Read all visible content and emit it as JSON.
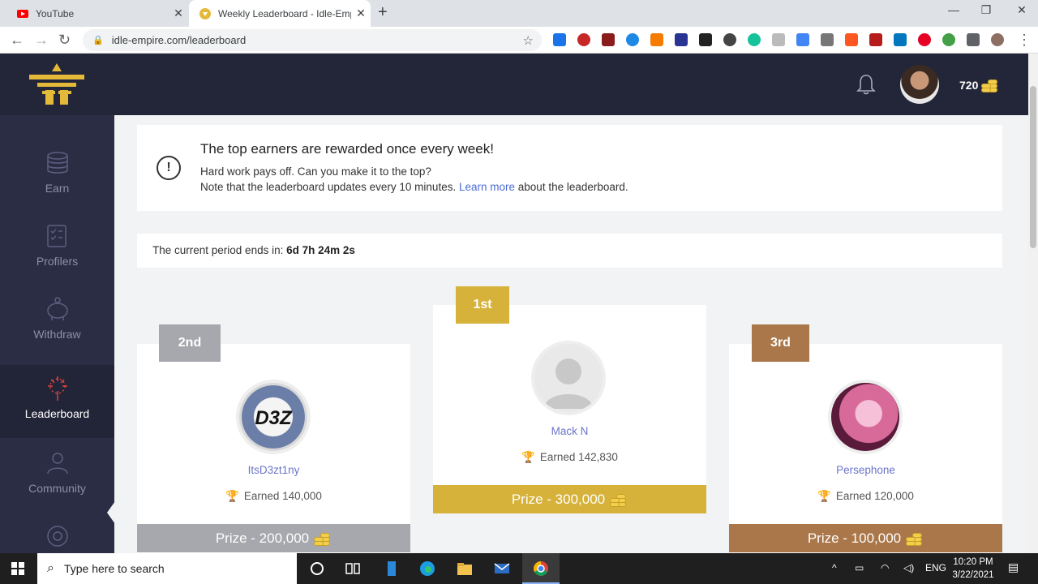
{
  "browser": {
    "tabs": [
      {
        "title": "YouTube",
        "active": false
      },
      {
        "title": "Weekly Leaderboard - Idle-Empir",
        "active": true
      }
    ],
    "url": "idle-empire.com/leaderboard"
  },
  "header": {
    "coins": "720"
  },
  "sidebar": {
    "items": [
      {
        "label": "Earn",
        "icon": "coins-icon"
      },
      {
        "label": "Profilers",
        "icon": "checklist-icon"
      },
      {
        "label": "Withdraw",
        "icon": "piggy-bank-icon"
      },
      {
        "label": "Leaderboard",
        "icon": "fireworks-icon",
        "active": true
      },
      {
        "label": "Community",
        "icon": "people-icon"
      }
    ]
  },
  "notice": {
    "title": "The top earners are rewarded once every week!",
    "line1": "Hard work pays off. Can you make it to the top?",
    "line2_pre": "Note that the leaderboard updates every 10 minutes.",
    "link": "Learn more",
    "line2_post": "about the leaderboard."
  },
  "period": {
    "label": "The current period ends in:",
    "value": "6d 7h 24m 2s"
  },
  "podium": {
    "first": {
      "rank": "1st",
      "name": "Mack N",
      "earned": "Earned 142,830",
      "prize": "Prize - 300,000",
      "color": "#d6b23a"
    },
    "second": {
      "rank": "2nd",
      "name": "ItsD3zt1ny",
      "earned": "Earned 140,000",
      "prize": "Prize - 200,000",
      "color": "#a7a8ad",
      "avatar_text": "D3Z"
    },
    "third": {
      "rank": "3rd",
      "name": "Persephone",
      "earned": "Earned 120,000",
      "prize": "Prize - 100,000",
      "color": "#aa774a"
    }
  },
  "taskbar": {
    "search_placeholder": "Type here to search",
    "lang": "ENG",
    "time": "10:20 PM",
    "date": "3/22/2021"
  }
}
